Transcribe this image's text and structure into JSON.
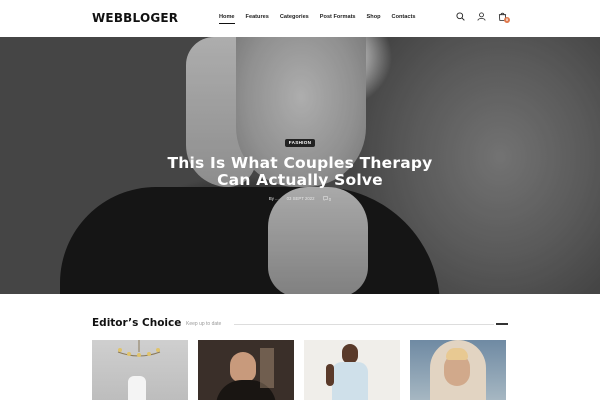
{
  "site": {
    "logo": "WEBBLOGER"
  },
  "nav": {
    "items": [
      {
        "label": "Home"
      },
      {
        "label": "Features"
      },
      {
        "label": "Categories"
      },
      {
        "label": "Post Formats"
      },
      {
        "label": "Shop"
      },
      {
        "label": "Contacts"
      }
    ]
  },
  "header_icons": {
    "search": "search-icon",
    "account": "user-icon",
    "cart": "cart-icon",
    "cart_count": "0"
  },
  "hero": {
    "tag": "FASHION",
    "title_line1": "This Is What Couples Therapy",
    "title_line2": "Can Actually Solve",
    "meta_author": "By ...",
    "meta_date": "03 SEPT 2022",
    "meta_comments": "0"
  },
  "section": {
    "title": "Editor’s Choice",
    "subtitle": "Keep up to date"
  }
}
